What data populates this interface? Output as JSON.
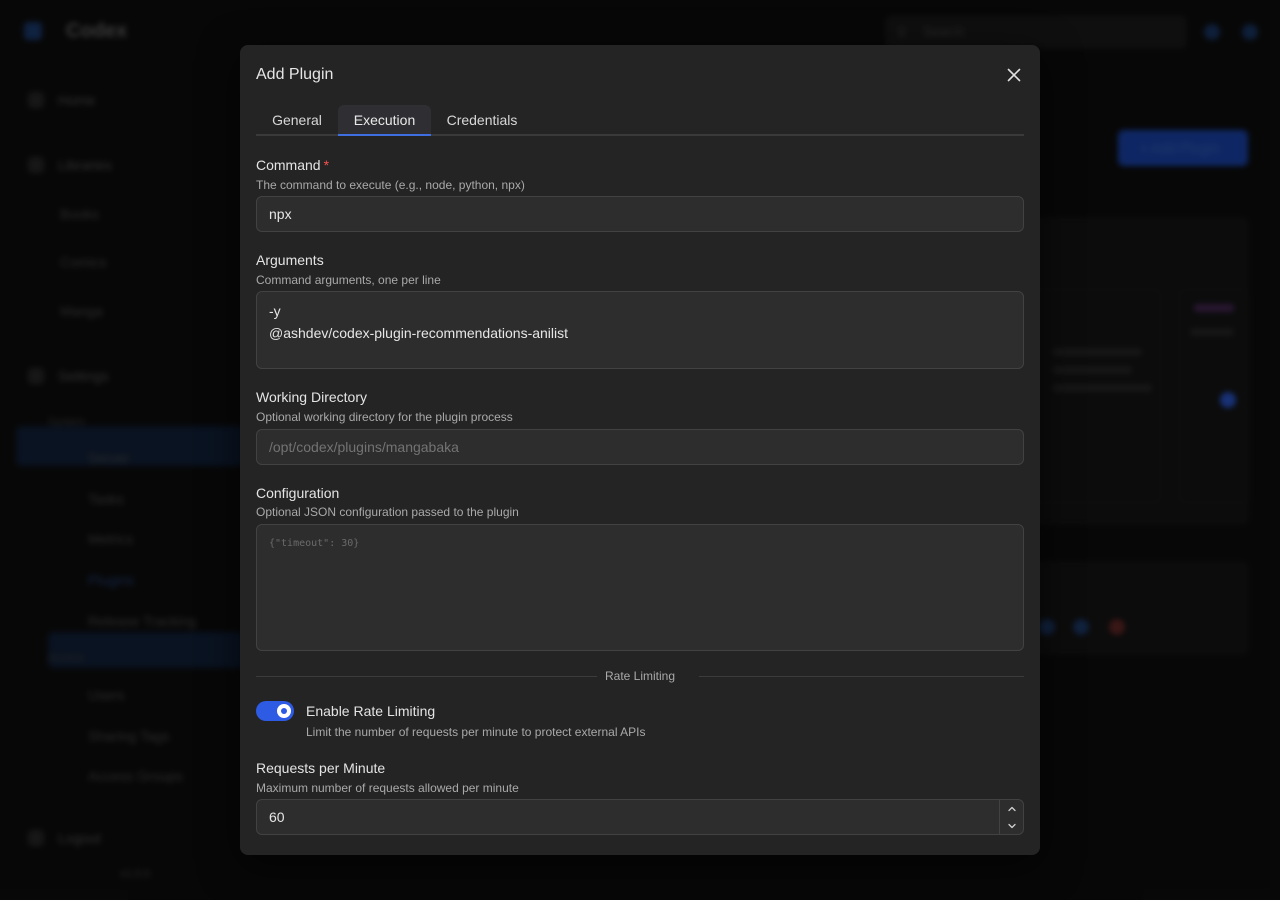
{
  "background": {
    "app_title": "Codex",
    "search_placeholder": "Search",
    "nav": {
      "home": "Home",
      "libraries": "Libraries",
      "books": "Books",
      "comics": "Comics",
      "manga": "Manga",
      "settings": "Settings",
      "group_system": "System",
      "server": "Server",
      "tasks": "Tasks",
      "metrics": "Metrics",
      "plugins": "Plugins",
      "release_tracking": "Release Tracking",
      "group_access": "Access",
      "users": "Users",
      "sharing_tags": "Sharing Tags",
      "access_groups": "Access Groups",
      "logout": "Logout",
      "version": "v1.0.0"
    },
    "add_plugin_button": "+ Add Plugin"
  },
  "modal": {
    "title": "Add Plugin",
    "tabs": [
      {
        "label": "General",
        "active": false
      },
      {
        "label": "Execution",
        "active": true
      },
      {
        "label": "Credentials",
        "active": false
      }
    ],
    "command": {
      "label": "Command",
      "required_mark": "*",
      "description": "The command to execute (e.g., node, python, npx)",
      "value": "npx"
    },
    "arguments": {
      "label": "Arguments",
      "description": "Command arguments, one per line",
      "lines": [
        "-y",
        "@ashdev/codex-plugin-recommendations-anilist"
      ]
    },
    "working_directory": {
      "label": "Working Directory",
      "description": "Optional working directory for the plugin process",
      "placeholder": "/opt/codex/plugins/mangabaka"
    },
    "configuration": {
      "label": "Configuration",
      "description": "Optional JSON configuration passed to the plugin",
      "placeholder": "{\"timeout\": 30}"
    },
    "rate_limiting": {
      "divider_label": "Rate Limiting",
      "toggle_label": "Enable Rate Limiting",
      "toggle_description": "Limit the number of requests per minute to protect external APIs",
      "enabled": true
    },
    "requests_per_minute": {
      "label": "Requests per Minute",
      "description": "Maximum number of requests allowed per minute",
      "value": "60"
    }
  },
  "colors": {
    "accent": "#2d5be3",
    "required": "#fa5252",
    "modal_bg": "#242424",
    "input_bg": "#2d2d2d"
  },
  "icons": {
    "close": "close-icon",
    "stepper_up": "chevron-up-icon",
    "stepper_down": "chevron-down-icon"
  }
}
